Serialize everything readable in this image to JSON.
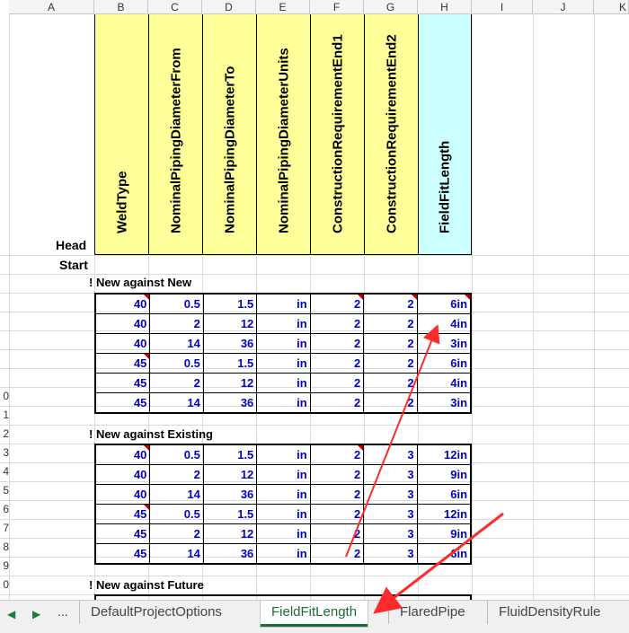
{
  "columns": [
    "A",
    "B",
    "C",
    "D",
    "E",
    "F",
    "G",
    "H",
    "I",
    "J",
    "K"
  ],
  "headers": [
    "WeldType",
    "NominalPipingDiameterFrom",
    "NominalPipingDiameterTo",
    "NominalPipingDiameterUnits",
    "ConstructionRequirementEnd1",
    "ConstructionRequirementEnd2",
    "FieldFitLength"
  ],
  "head_label": "Head",
  "start_label": "Start",
  "row_numbers": [
    "",
    "",
    "",
    "",
    "",
    "",
    "",
    "",
    "",
    "",
    "",
    "",
    "",
    "",
    "0",
    "1",
    "2",
    "3",
    "4",
    "5",
    "6",
    "7",
    "8",
    "9",
    "0"
  ],
  "sections": [
    {
      "title": "! New against New",
      "rows": [
        [
          "40",
          "0.5",
          "1.5",
          "in",
          "2",
          "2",
          "6in"
        ],
        [
          "40",
          "2",
          "12",
          "in",
          "2",
          "2",
          "4in"
        ],
        [
          "40",
          "14",
          "36",
          "in",
          "2",
          "2",
          "3in"
        ],
        [
          "45",
          "0.5",
          "1.5",
          "in",
          "2",
          "2",
          "6in"
        ],
        [
          "45",
          "2",
          "12",
          "in",
          "2",
          "2",
          "4in"
        ],
        [
          "45",
          "14",
          "36",
          "in",
          "2",
          "2",
          "3in"
        ]
      ]
    },
    {
      "title": "! New against Existing",
      "rows": [
        [
          "40",
          "0.5",
          "1.5",
          "in",
          "2",
          "3",
          "12in"
        ],
        [
          "40",
          "2",
          "12",
          "in",
          "2",
          "3",
          "9in"
        ],
        [
          "40",
          "14",
          "36",
          "in",
          "2",
          "3",
          "6in"
        ],
        [
          "45",
          "0.5",
          "1.5",
          "in",
          "2",
          "3",
          "12in"
        ],
        [
          "45",
          "2",
          "12",
          "in",
          "2",
          "3",
          "9in"
        ],
        [
          "45",
          "14",
          "36",
          "in",
          "2",
          "3",
          "6in"
        ]
      ]
    },
    {
      "title": "! New against Future",
      "rows": []
    }
  ],
  "tabs": {
    "nav_prev": "◀",
    "nav_next": "▶",
    "nav_more": "...",
    "items": [
      "DefaultProjectOptions",
      "FieldFitLength",
      "FlaredPipe",
      "FluidDensityRule"
    ],
    "active": "FieldFitLength"
  },
  "colors": {
    "header_yellow": "#ffff99",
    "header_cyan": "#ccffff",
    "value_blue": "#0000cc",
    "tab_green": "#1d6b35",
    "arrow_red": "#ff2b2b"
  }
}
